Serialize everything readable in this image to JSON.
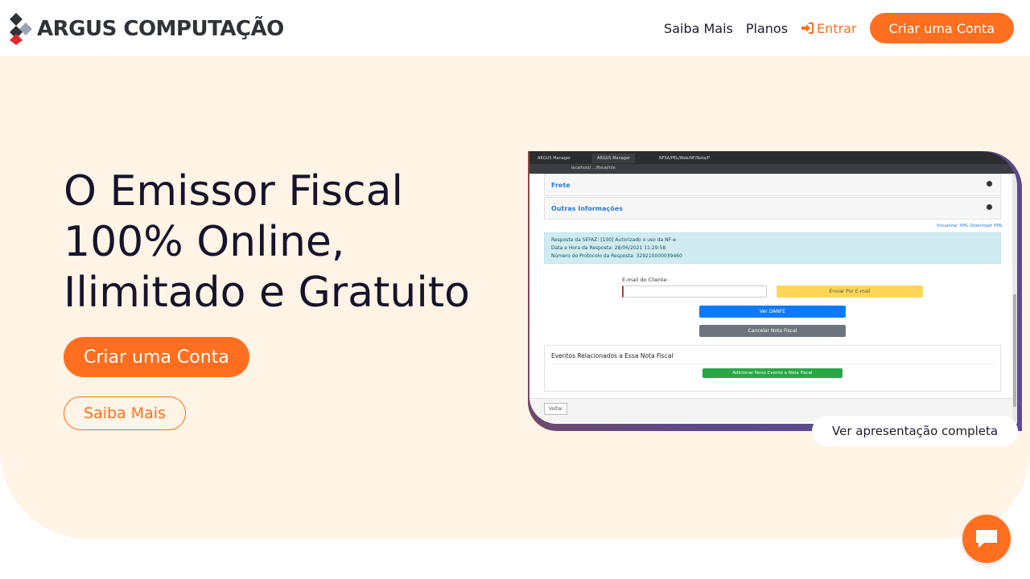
{
  "nav": {
    "brand": "ARGUS COMPUTAÇÃO",
    "links": [
      "Saiba Mais",
      "Planos"
    ],
    "login": "Entrar",
    "cta": "Criar uma Conta"
  },
  "hero": {
    "title_lines": [
      "O Emissor Fiscal",
      "100% Online,",
      "Ilimitado e Gratuito"
    ],
    "primary_button": "Criar uma Conta",
    "secondary_button": "Saiba Mais",
    "presentation_button": "Ver apresentação completa"
  },
  "screenshot": {
    "tabs": [
      "ARGUS Manager",
      "ARGUS Manager",
      "NFSA/PEL/Web/NF/Nota/P"
    ],
    "address": "localhost/..../fiscal/nfe",
    "rows": [
      "Frete",
      "Outras Informações"
    ],
    "xml_links": "Visualizar XML  Download XML",
    "alert_lines": [
      "Resposta da SEFAZ: [100] Autorizado o uso da NF-e",
      "Data e Hora da Resposta: 28/06/2021 11:29:58",
      "Número do Protocolo da Resposta: 329210000039460"
    ],
    "email_label": "E-mail do Cliente:",
    "send_email": "Enviar Por E-mail",
    "view_danfe": "Ver DANFE",
    "cancel_note": "Cancelar Nota Fiscal",
    "events_title": "Eventos Relacionados a Essa Nota Fiscal",
    "add_event": "Adicionar Novo Evento a Nota Fiscal",
    "back": "Voltar"
  },
  "colors": {
    "accent": "#ff6f1f",
    "hero_bg": "#fff4e5",
    "heading": "#17132b"
  },
  "icons": {
    "login": "sign-in-icon",
    "chat": "chat-bubble-icon",
    "logo": "argus-logo-icon"
  }
}
